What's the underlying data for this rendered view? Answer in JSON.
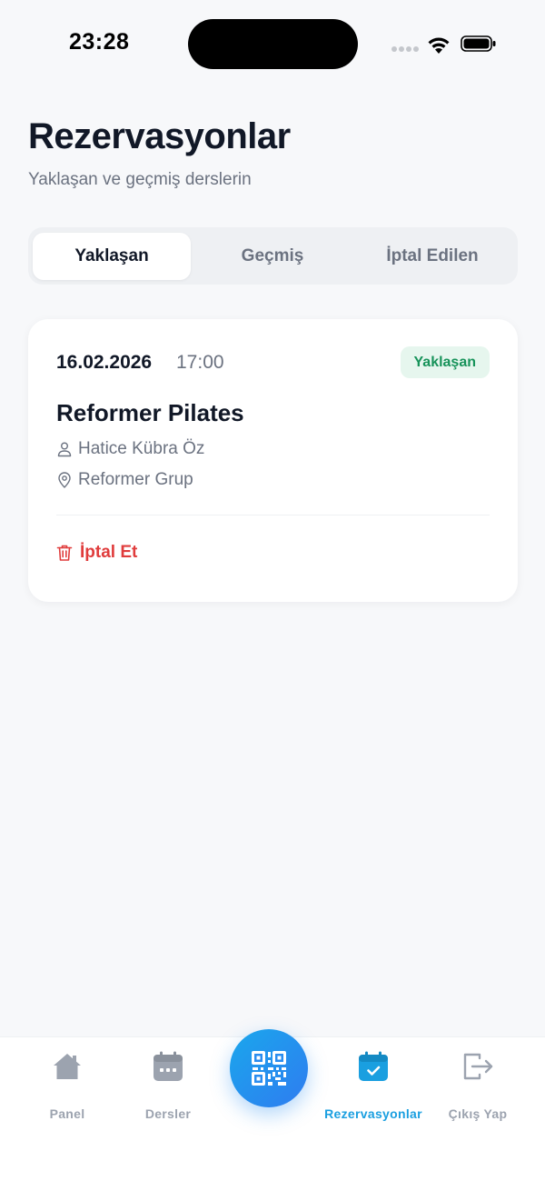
{
  "status_bar": {
    "time": "23:28"
  },
  "header": {
    "title": "Rezervasyonlar",
    "subtitle": "Yaklaşan ve geçmiş derslerin"
  },
  "tabs": [
    {
      "label": "Yaklaşan",
      "active": true
    },
    {
      "label": "Geçmiş",
      "active": false
    },
    {
      "label": "İptal Edilen",
      "active": false
    }
  ],
  "reservation": {
    "date": "16.02.2026",
    "time": "17:00",
    "status": "Yaklaşan",
    "class_name": "Reformer Pilates",
    "instructor": "Hatice Kübra Öz",
    "location": "Reformer Grup",
    "cancel_label": "İptal Et"
  },
  "bottom_nav": {
    "items": [
      {
        "label": "Panel",
        "icon": "home-icon",
        "active": false
      },
      {
        "label": "Dersler",
        "icon": "calendar-icon",
        "active": false
      },
      {
        "label": "Rezervasyonlar",
        "icon": "calendar-check-icon",
        "active": true
      },
      {
        "label": "Çıkış Yap",
        "icon": "logout-icon",
        "active": false
      }
    ],
    "center_button_icon": "qr-code-icon"
  },
  "colors": {
    "accent": "#1a9fe0",
    "badge_bg": "#e6f6ee",
    "badge_text": "#17935a",
    "danger": "#e03c3c",
    "background": "#f7f8fa"
  }
}
